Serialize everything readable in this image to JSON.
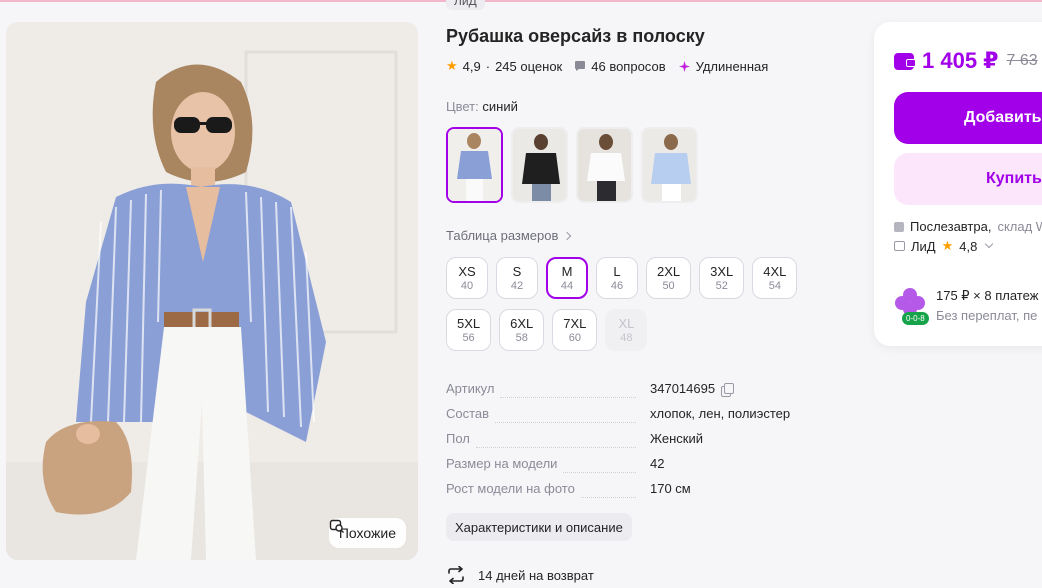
{
  "brand_tag": "ЛиД",
  "product": {
    "title": "Рубашка оверсайз в полоску",
    "rating": "4,9",
    "reviews": "245 оценок",
    "questions": "46 вопросов",
    "feature": "Удлиненная"
  },
  "photo": {
    "similar_label": "Похожие"
  },
  "color": {
    "label": "Цвет:",
    "value": "синий"
  },
  "swatches": [
    "blue-stripe",
    "black",
    "white",
    "light-blue"
  ],
  "size_table_label": "Таблица размеров",
  "sizes": [
    {
      "name": "XS",
      "ru": "40"
    },
    {
      "name": "S",
      "ru": "42"
    },
    {
      "name": "M",
      "ru": "44",
      "selected": true
    },
    {
      "name": "L",
      "ru": "46"
    },
    {
      "name": "2XL",
      "ru": "50"
    },
    {
      "name": "3XL",
      "ru": "52"
    },
    {
      "name": "4XL",
      "ru": "54"
    },
    {
      "name": "5XL",
      "ru": "56"
    },
    {
      "name": "6XL",
      "ru": "58"
    },
    {
      "name": "7XL",
      "ru": "60"
    },
    {
      "name": "XL",
      "ru": "48",
      "disabled": true
    }
  ],
  "specs": [
    {
      "key": "Артикул",
      "value": "347014695",
      "copy": true
    },
    {
      "key": "Состав",
      "value": "хлопок, лен, полиэстер"
    },
    {
      "key": "Пол",
      "value": "Женский"
    },
    {
      "key": "Размер на модели",
      "value": "42"
    },
    {
      "key": "Рост модели на фото",
      "value": "170 см"
    }
  ],
  "characteristics_button": "Характеристики и описание",
  "return_text": "14 дней на возврат",
  "card": {
    "price": "1 405 ₽",
    "old_price": "7 63",
    "add_label": "Добавить",
    "buy_label": "Купить",
    "delivery": "Послезавтра,",
    "delivery_sub": "склад W",
    "seller_name": "ЛиД",
    "seller_rating": "4,8",
    "installment_main": "175 ₽ × 8 платеж",
    "installment_sub": "Без переплат, пе",
    "installment_badge": "0-0-8"
  },
  "colors": {
    "accent": "#a100e8",
    "accent_light": "#fbe6fb",
    "star": "#ff9d00",
    "muted": "#8b8b98"
  }
}
